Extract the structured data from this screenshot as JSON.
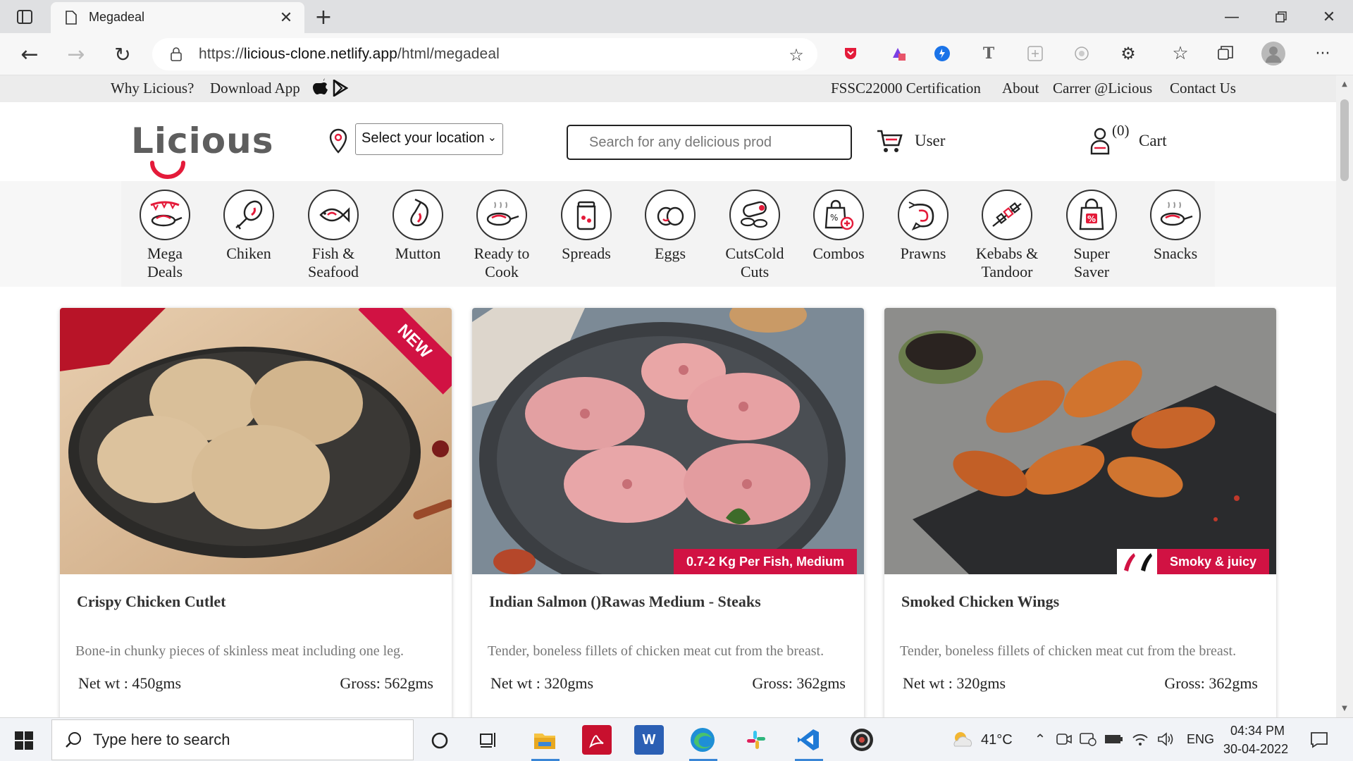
{
  "browser": {
    "tab_title": "Megadeal",
    "url_prefix": "https://",
    "url_host": "licious-clone.netlify.app",
    "url_path": "/html/megadeal"
  },
  "topbar": {
    "why": "Why Licious?",
    "download": "Download App",
    "cert": "FSSC22000 Certification",
    "about": "About",
    "career": "Carrer @Licious",
    "contact": "Contact Us"
  },
  "header": {
    "logo": "Licious",
    "location_placeholder": "Select your location",
    "search_placeholder": "Search for any delicious prod",
    "user_label": "User",
    "cart_count": "(0)",
    "cart_label": "Cart"
  },
  "categories": [
    {
      "line1": "Mega",
      "line2": "Deals"
    },
    {
      "line1": "Chiken",
      "line2": ""
    },
    {
      "line1": "Fish &",
      "line2": "Seafood"
    },
    {
      "line1": "Mutton",
      "line2": ""
    },
    {
      "line1": "Ready to",
      "line2": "Cook"
    },
    {
      "line1": "Spreads",
      "line2": ""
    },
    {
      "line1": "Eggs",
      "line2": ""
    },
    {
      "line1": "CutsCold",
      "line2": "Cuts"
    },
    {
      "line1": "Combos",
      "line2": ""
    },
    {
      "line1": "Prawns",
      "line2": ""
    },
    {
      "line1": "Kebabs &",
      "line2": "Tandoor"
    },
    {
      "line1": "Super",
      "line2": "Saver"
    },
    {
      "line1": "Snacks",
      "line2": ""
    }
  ],
  "products": [
    {
      "title": "Crispy Chicken Cutlet",
      "description": "Bone-in chunky pieces of skinless meat including one leg.",
      "net": "Net wt : 450gms",
      "gross": "Gross: 562gms",
      "badge": "NEW",
      "tag": ""
    },
    {
      "title": "Indian Salmon ()Rawas Medium - Steaks",
      "description": "Tender, boneless fillets of chicken meat cut from the breast.",
      "net": "Net wt : 320gms",
      "gross": "Gross: 362gms",
      "badge": "",
      "tag": "0.7-2 Kg Per Fish, Medium"
    },
    {
      "title": "Smoked Chicken Wings",
      "description": "Tender, boneless fillets of chicken meat cut from the breast.",
      "net": "Net wt : 320gms",
      "gross": "Gross: 362gms",
      "badge": "",
      "tag": "Smoky & juicy"
    }
  ],
  "taskbar": {
    "search_placeholder": "Type here to search",
    "temperature": "41°C",
    "language": "ENG",
    "time": "04:34 PM",
    "date": "30-04-2022"
  },
  "colors": {
    "brand_red": "#d11243",
    "accent_red": "#e41b3a"
  }
}
